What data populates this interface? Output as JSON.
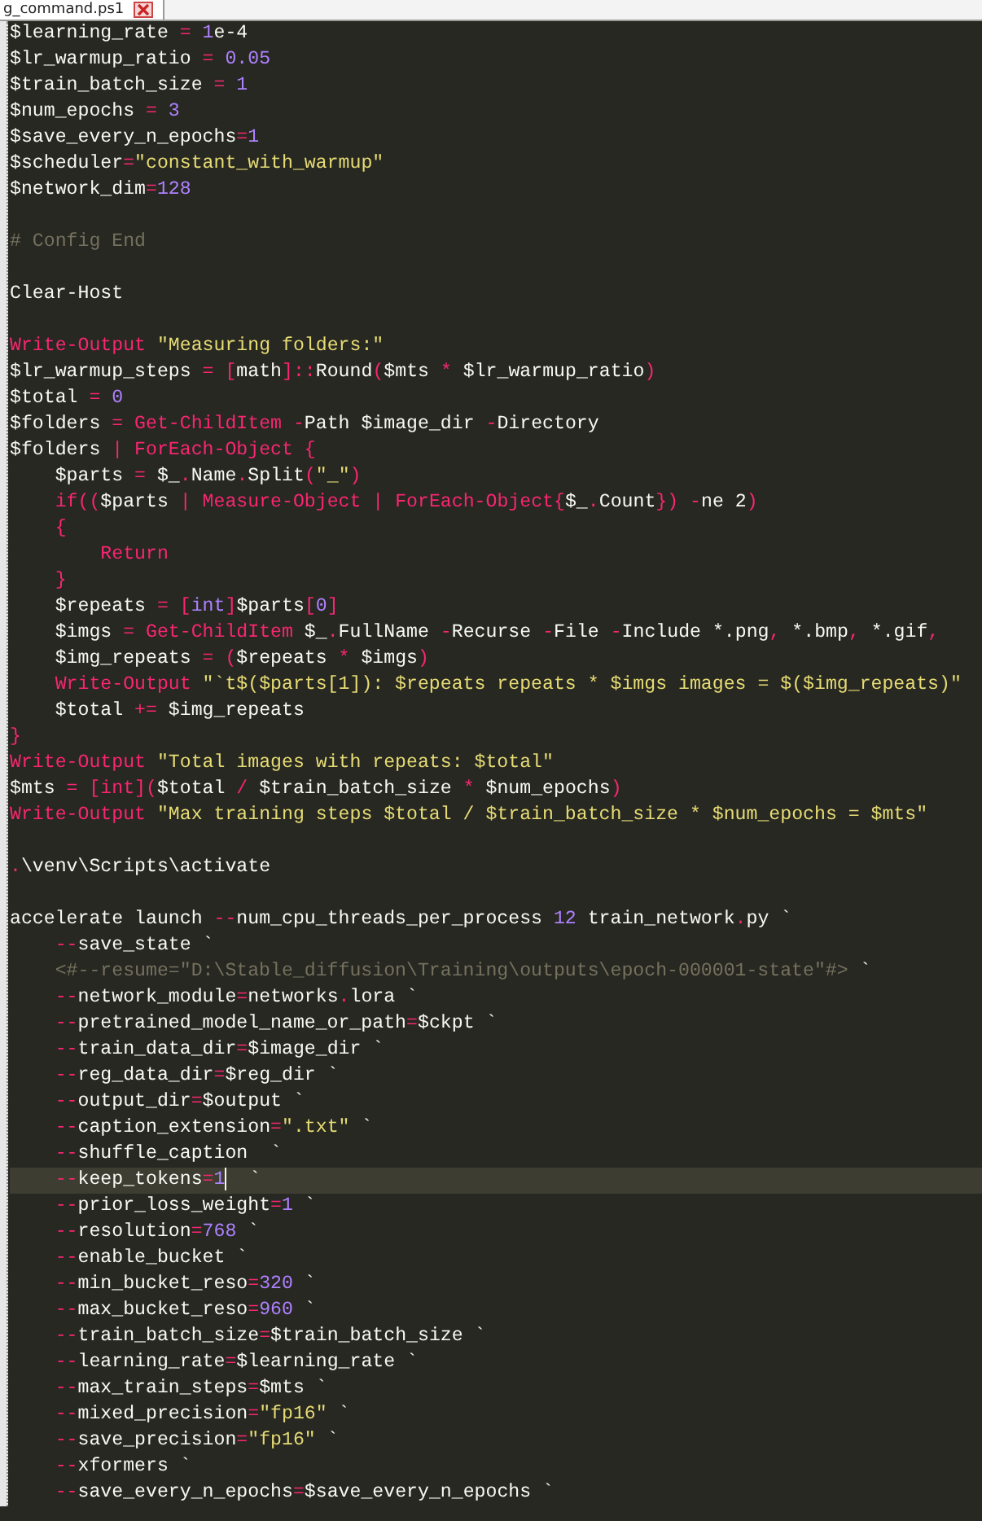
{
  "tab": {
    "title": "g_command.ps1"
  },
  "lines": [
    {
      "current": false,
      "tokens": [
        {
          "kind": "plain",
          "text": "$learning_rate "
        },
        {
          "kind": "keyword",
          "text": "="
        },
        {
          "kind": "number",
          "text": " 1"
        },
        {
          "kind": "plain",
          "text": "e-4"
        }
      ]
    },
    {
      "current": false,
      "tokens": [
        {
          "kind": "plain",
          "text": "$lr_warmup_ratio "
        },
        {
          "kind": "keyword",
          "text": "="
        },
        {
          "kind": "number",
          "text": " 0.05"
        }
      ]
    },
    {
      "current": false,
      "tokens": [
        {
          "kind": "plain",
          "text": "$train_batch_size "
        },
        {
          "kind": "keyword",
          "text": "="
        },
        {
          "kind": "number",
          "text": " 1"
        }
      ]
    },
    {
      "current": false,
      "tokens": [
        {
          "kind": "plain",
          "text": "$num_epochs "
        },
        {
          "kind": "keyword",
          "text": "="
        },
        {
          "kind": "number",
          "text": " 3"
        }
      ]
    },
    {
      "current": false,
      "tokens": [
        {
          "kind": "plain",
          "text": "$save_every_n_epochs"
        },
        {
          "kind": "keyword",
          "text": "="
        },
        {
          "kind": "number",
          "text": "1"
        }
      ]
    },
    {
      "current": false,
      "tokens": [
        {
          "kind": "plain",
          "text": "$scheduler"
        },
        {
          "kind": "keyword",
          "text": "="
        },
        {
          "kind": "string",
          "text": "\"constant_with_warmup\""
        }
      ]
    },
    {
      "current": false,
      "tokens": [
        {
          "kind": "plain",
          "text": "$network_dim"
        },
        {
          "kind": "keyword",
          "text": "="
        },
        {
          "kind": "number",
          "text": "128"
        }
      ]
    },
    {
      "current": false
    },
    {
      "current": false,
      "tokens": [
        {
          "kind": "comment",
          "text": "# Config End"
        }
      ]
    },
    {
      "current": false
    },
    {
      "current": false,
      "tokens": [
        {
          "kind": "plain",
          "text": "Clear-Host"
        }
      ]
    },
    {
      "current": false
    },
    {
      "current": false,
      "tokens": [
        {
          "kind": "keyword",
          "text": "Write-Output"
        },
        {
          "kind": "string",
          "text": " \"Measuring folders:\""
        }
      ]
    },
    {
      "current": false,
      "tokens": [
        {
          "kind": "plain",
          "text": "$lr_warmup_steps "
        },
        {
          "kind": "keyword",
          "text": "="
        },
        {
          "kind": "keyword",
          "text": " ["
        },
        {
          "kind": "plain",
          "text": "math"
        },
        {
          "kind": "keyword",
          "text": "]::"
        },
        {
          "kind": "plain",
          "text": "Round"
        },
        {
          "kind": "keyword",
          "text": "("
        },
        {
          "kind": "plain",
          "text": "$mts "
        },
        {
          "kind": "keyword",
          "text": "*"
        },
        {
          "kind": "plain",
          "text": " $lr_warmup_ratio"
        },
        {
          "kind": "keyword",
          "text": ")"
        }
      ]
    },
    {
      "current": false,
      "tokens": [
        {
          "kind": "plain",
          "text": "$total "
        },
        {
          "kind": "keyword",
          "text": "="
        },
        {
          "kind": "number",
          "text": " 0"
        }
      ]
    },
    {
      "current": false,
      "tokens": [
        {
          "kind": "plain",
          "text": "$folders "
        },
        {
          "kind": "keyword",
          "text": "="
        },
        {
          "kind": "keyword",
          "text": " Get-ChildItem"
        },
        {
          "kind": "keyword",
          "text": " -"
        },
        {
          "kind": "plain",
          "text": "Path $image_dir "
        },
        {
          "kind": "keyword",
          "text": "-"
        },
        {
          "kind": "plain",
          "text": "Directory"
        }
      ]
    },
    {
      "current": false,
      "tokens": [
        {
          "kind": "plain",
          "text": "$folders "
        },
        {
          "kind": "keyword",
          "text": "|"
        },
        {
          "kind": "keyword",
          "text": " ForEach-Object"
        },
        {
          "kind": "keyword",
          "text": " {"
        }
      ]
    },
    {
      "current": false,
      "tokens": [
        {
          "kind": "plain",
          "text": "    $parts "
        },
        {
          "kind": "keyword",
          "text": "="
        },
        {
          "kind": "plain",
          "text": " $_"
        },
        {
          "kind": "keyword",
          "text": "."
        },
        {
          "kind": "plain",
          "text": "Name"
        },
        {
          "kind": "keyword",
          "text": "."
        },
        {
          "kind": "plain",
          "text": "Split"
        },
        {
          "kind": "keyword",
          "text": "("
        },
        {
          "kind": "string",
          "text": "\"_\""
        },
        {
          "kind": "keyword",
          "text": ")"
        }
      ]
    },
    {
      "current": false,
      "tokens": [
        {
          "kind": "keyword",
          "text": "    if(("
        },
        {
          "kind": "plain",
          "text": "$parts "
        },
        {
          "kind": "keyword",
          "text": "|"
        },
        {
          "kind": "keyword",
          "text": " Measure-Object"
        },
        {
          "kind": "keyword",
          "text": " |"
        },
        {
          "kind": "keyword",
          "text": " ForEach-Object{"
        },
        {
          "kind": "plain",
          "text": "$_"
        },
        {
          "kind": "keyword",
          "text": "."
        },
        {
          "kind": "plain",
          "text": "Count"
        },
        {
          "kind": "keyword",
          "text": "})"
        },
        {
          "kind": "keyword",
          "text": " -"
        },
        {
          "kind": "plain",
          "text": "ne 2"
        },
        {
          "kind": "keyword",
          "text": ")"
        }
      ]
    },
    {
      "current": false,
      "tokens": [
        {
          "kind": "keyword",
          "text": "    {"
        }
      ]
    },
    {
      "current": false,
      "tokens": [
        {
          "kind": "keyword",
          "text": "        Return"
        }
      ]
    },
    {
      "current": false,
      "tokens": [
        {
          "kind": "keyword",
          "text": "    }"
        }
      ]
    },
    {
      "current": false,
      "tokens": [
        {
          "kind": "plain",
          "text": "    $repeats "
        },
        {
          "kind": "keyword",
          "text": "="
        },
        {
          "kind": "keyword",
          "text": " ["
        },
        {
          "kind": "number",
          "text": "int"
        },
        {
          "kind": "keyword",
          "text": "]"
        },
        {
          "kind": "plain",
          "text": "$parts"
        },
        {
          "kind": "keyword",
          "text": "["
        },
        {
          "kind": "number",
          "text": "0"
        },
        {
          "kind": "keyword",
          "text": "]"
        }
      ]
    },
    {
      "current": false,
      "tokens": [
        {
          "kind": "plain",
          "text": "    $imgs "
        },
        {
          "kind": "keyword",
          "text": "="
        },
        {
          "kind": "keyword",
          "text": " Get-ChildItem"
        },
        {
          "kind": "plain",
          "text": " $_"
        },
        {
          "kind": "keyword",
          "text": "."
        },
        {
          "kind": "plain",
          "text": "FullName "
        },
        {
          "kind": "keyword",
          "text": "-"
        },
        {
          "kind": "plain",
          "text": "Recurse "
        },
        {
          "kind": "keyword",
          "text": "-"
        },
        {
          "kind": "plain",
          "text": "File "
        },
        {
          "kind": "keyword",
          "text": "-"
        },
        {
          "kind": "plain",
          "text": "Include *.png"
        },
        {
          "kind": "keyword",
          "text": ","
        },
        {
          "kind": "plain",
          "text": " *.bmp"
        },
        {
          "kind": "keyword",
          "text": ","
        },
        {
          "kind": "plain",
          "text": " *.gif"
        },
        {
          "kind": "keyword",
          "text": ","
        }
      ]
    },
    {
      "current": false,
      "tokens": [
        {
          "kind": "plain",
          "text": "    $img_repeats "
        },
        {
          "kind": "keyword",
          "text": "="
        },
        {
          "kind": "keyword",
          "text": " ("
        },
        {
          "kind": "plain",
          "text": "$repeats "
        },
        {
          "kind": "keyword",
          "text": "*"
        },
        {
          "kind": "plain",
          "text": " $imgs"
        },
        {
          "kind": "keyword",
          "text": ")"
        }
      ]
    },
    {
      "current": false,
      "tokens": [
        {
          "kind": "keyword",
          "text": "    Write-Output"
        },
        {
          "kind": "string",
          "text": " \"`t$($parts[1]): $repeats repeats * $imgs images = $($img_repeats)\""
        }
      ]
    },
    {
      "current": false,
      "tokens": [
        {
          "kind": "plain",
          "text": "    $total "
        },
        {
          "kind": "keyword",
          "text": "+="
        },
        {
          "kind": "plain",
          "text": " $img_repeats"
        }
      ]
    },
    {
      "current": false,
      "tokens": [
        {
          "kind": "keyword",
          "text": "}"
        }
      ]
    },
    {
      "current": false,
      "tokens": [
        {
          "kind": "keyword",
          "text": "Write-Output"
        },
        {
          "kind": "string",
          "text": " \"Total images with repeats: $total\""
        }
      ]
    },
    {
      "current": false,
      "tokens": [
        {
          "kind": "plain",
          "text": "$mts "
        },
        {
          "kind": "keyword",
          "text": "="
        },
        {
          "kind": "keyword",
          "text": " [int]("
        },
        {
          "kind": "plain",
          "text": "$total "
        },
        {
          "kind": "keyword",
          "text": "/"
        },
        {
          "kind": "plain",
          "text": " $train_batch_size "
        },
        {
          "kind": "keyword",
          "text": "*"
        },
        {
          "kind": "plain",
          "text": " $num_epochs"
        },
        {
          "kind": "keyword",
          "text": ")"
        }
      ]
    },
    {
      "current": false,
      "tokens": [
        {
          "kind": "keyword",
          "text": "Write-Output"
        },
        {
          "kind": "string",
          "text": " \"Max training steps $total / $train_batch_size * $num_epochs = $mts\""
        }
      ]
    },
    {
      "current": false
    },
    {
      "current": false,
      "tokens": [
        {
          "kind": "keyword",
          "text": "."
        },
        {
          "kind": "plain",
          "text": "\\venv\\Scripts\\activate"
        }
      ]
    },
    {
      "current": false
    },
    {
      "current": false,
      "tokens": [
        {
          "kind": "plain",
          "text": "accelerate launch "
        },
        {
          "kind": "keyword",
          "text": "--"
        },
        {
          "kind": "plain",
          "text": "num_cpu_threads_per_process "
        },
        {
          "kind": "number",
          "text": "12"
        },
        {
          "kind": "plain",
          "text": " train_network"
        },
        {
          "kind": "keyword",
          "text": "."
        },
        {
          "kind": "plain",
          "text": "py `"
        }
      ]
    },
    {
      "current": false,
      "tokens": [
        {
          "kind": "keyword",
          "text": "    --"
        },
        {
          "kind": "plain",
          "text": "save_state `"
        }
      ]
    },
    {
      "current": false,
      "tokens": [
        {
          "kind": "comment",
          "text": "    <#--resume=\"D:\\Stable_diffusion\\Training\\outputs\\epoch-000001-state\"#>"
        },
        {
          "kind": "plain",
          "text": " `"
        }
      ]
    },
    {
      "current": false,
      "tokens": [
        {
          "kind": "keyword",
          "text": "    --"
        },
        {
          "kind": "plain",
          "text": "network_module"
        },
        {
          "kind": "keyword",
          "text": "="
        },
        {
          "kind": "plain",
          "text": "networks"
        },
        {
          "kind": "keyword",
          "text": "."
        },
        {
          "kind": "plain",
          "text": "lora `"
        }
      ]
    },
    {
      "current": false,
      "tokens": [
        {
          "kind": "keyword",
          "text": "    --"
        },
        {
          "kind": "plain",
          "text": "pretrained_model_name_or_path"
        },
        {
          "kind": "keyword",
          "text": "="
        },
        {
          "kind": "plain",
          "text": "$ckpt `"
        }
      ]
    },
    {
      "current": false,
      "tokens": [
        {
          "kind": "keyword",
          "text": "    --"
        },
        {
          "kind": "plain",
          "text": "train_data_dir"
        },
        {
          "kind": "keyword",
          "text": "="
        },
        {
          "kind": "plain",
          "text": "$image_dir `"
        }
      ]
    },
    {
      "current": false,
      "tokens": [
        {
          "kind": "keyword",
          "text": "    --"
        },
        {
          "kind": "plain",
          "text": "reg_data_dir"
        },
        {
          "kind": "keyword",
          "text": "="
        },
        {
          "kind": "plain",
          "text": "$reg_dir `"
        }
      ]
    },
    {
      "current": false,
      "tokens": [
        {
          "kind": "keyword",
          "text": "    --"
        },
        {
          "kind": "plain",
          "text": "output_dir"
        },
        {
          "kind": "keyword",
          "text": "="
        },
        {
          "kind": "plain",
          "text": "$output `"
        }
      ]
    },
    {
      "current": false,
      "tokens": [
        {
          "kind": "keyword",
          "text": "    --"
        },
        {
          "kind": "plain",
          "text": "caption_extension"
        },
        {
          "kind": "keyword",
          "text": "="
        },
        {
          "kind": "string",
          "text": "\".txt\""
        },
        {
          "kind": "plain",
          "text": " `"
        }
      ]
    },
    {
      "current": false,
      "tokens": [
        {
          "kind": "keyword",
          "text": "    --"
        },
        {
          "kind": "plain",
          "text": "shuffle_caption  `"
        }
      ]
    },
    {
      "current": true,
      "tokens": [
        {
          "kind": "keyword",
          "text": "    --"
        },
        {
          "kind": "plain",
          "text": "keep_tokens"
        },
        {
          "kind": "keyword",
          "text": "="
        },
        {
          "kind": "number",
          "text": "1"
        },
        {
          "kind": "plain",
          "text": "  `"
        }
      ]
    },
    {
      "current": false,
      "tokens": [
        {
          "kind": "keyword",
          "text": "    --"
        },
        {
          "kind": "plain",
          "text": "prior_loss_weight"
        },
        {
          "kind": "keyword",
          "text": "="
        },
        {
          "kind": "number",
          "text": "1"
        },
        {
          "kind": "plain",
          "text": " `"
        }
      ]
    },
    {
      "current": false,
      "tokens": [
        {
          "kind": "keyword",
          "text": "    --"
        },
        {
          "kind": "plain",
          "text": "resolution"
        },
        {
          "kind": "keyword",
          "text": "="
        },
        {
          "kind": "number",
          "text": "768"
        },
        {
          "kind": "plain",
          "text": " `"
        }
      ]
    },
    {
      "current": false,
      "tokens": [
        {
          "kind": "keyword",
          "text": "    --"
        },
        {
          "kind": "plain",
          "text": "enable_bucket `"
        }
      ]
    },
    {
      "current": false,
      "tokens": [
        {
          "kind": "keyword",
          "text": "    --"
        },
        {
          "kind": "plain",
          "text": "min_bucket_reso"
        },
        {
          "kind": "keyword",
          "text": "="
        },
        {
          "kind": "number",
          "text": "320"
        },
        {
          "kind": "plain",
          "text": " `"
        }
      ]
    },
    {
      "current": false,
      "tokens": [
        {
          "kind": "keyword",
          "text": "    --"
        },
        {
          "kind": "plain",
          "text": "max_bucket_reso"
        },
        {
          "kind": "keyword",
          "text": "="
        },
        {
          "kind": "number",
          "text": "960"
        },
        {
          "kind": "plain",
          "text": " `"
        }
      ]
    },
    {
      "current": false,
      "tokens": [
        {
          "kind": "keyword",
          "text": "    --"
        },
        {
          "kind": "plain",
          "text": "train_batch_size"
        },
        {
          "kind": "keyword",
          "text": "="
        },
        {
          "kind": "plain",
          "text": "$train_batch_size `"
        }
      ]
    },
    {
      "current": false,
      "tokens": [
        {
          "kind": "keyword",
          "text": "    --"
        },
        {
          "kind": "plain",
          "text": "learning_rate"
        },
        {
          "kind": "keyword",
          "text": "="
        },
        {
          "kind": "plain",
          "text": "$learning_rate `"
        }
      ]
    },
    {
      "current": false,
      "tokens": [
        {
          "kind": "keyword",
          "text": "    --"
        },
        {
          "kind": "plain",
          "text": "max_train_steps"
        },
        {
          "kind": "keyword",
          "text": "="
        },
        {
          "kind": "plain",
          "text": "$mts `"
        }
      ]
    },
    {
      "current": false,
      "tokens": [
        {
          "kind": "keyword",
          "text": "    --"
        },
        {
          "kind": "plain",
          "text": "mixed_precision"
        },
        {
          "kind": "keyword",
          "text": "="
        },
        {
          "kind": "string",
          "text": "\"fp16\""
        },
        {
          "kind": "plain",
          "text": " `"
        }
      ]
    },
    {
      "current": false,
      "tokens": [
        {
          "kind": "keyword",
          "text": "    --"
        },
        {
          "kind": "plain",
          "text": "save_precision"
        },
        {
          "kind": "keyword",
          "text": "="
        },
        {
          "kind": "string",
          "text": "\"fp16\""
        },
        {
          "kind": "plain",
          "text": " `"
        }
      ]
    },
    {
      "current": false,
      "tokens": [
        {
          "kind": "keyword",
          "text": "    --"
        },
        {
          "kind": "plain",
          "text": "xformers `"
        }
      ]
    },
    {
      "current": false,
      "tokens": [
        {
          "kind": "keyword",
          "text": "    --"
        },
        {
          "kind": "plain",
          "text": "save_every_n_epochs"
        },
        {
          "kind": "keyword",
          "text": "="
        },
        {
          "kind": "plain",
          "text": "$save_every_n_epochs `"
        }
      ]
    }
  ]
}
